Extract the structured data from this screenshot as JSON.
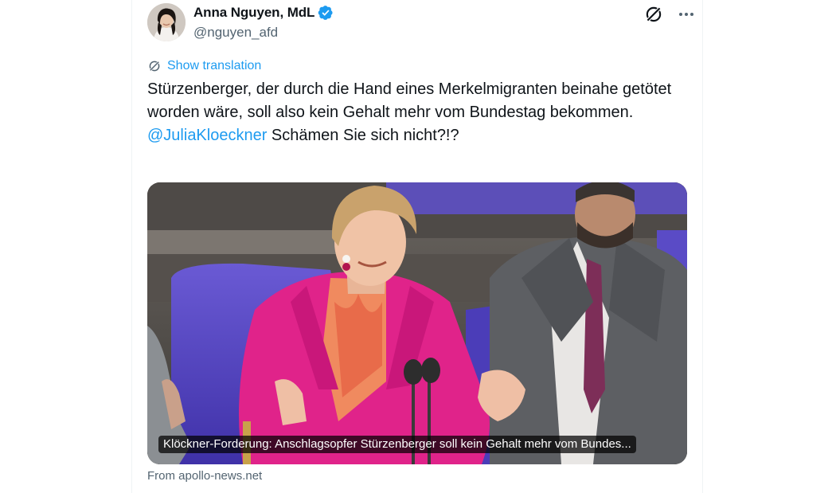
{
  "author": {
    "display_name": "Anna Nguyen, MdL",
    "handle": "@nguyen_afd",
    "verified": true,
    "avatar_icon": "profile-photo"
  },
  "actions": {
    "grok_icon": "grok-slash-circle-icon",
    "more_icon": "more-dots-icon"
  },
  "translation": {
    "label": "Show translation",
    "icon": "translate-icon"
  },
  "tweet": {
    "paragraph1": "Stürzenberger, der durch die Hand eines Merkelmigranten beinahe getötet worden wäre, soll also kein Gehalt mehr vom Bundestag bekommen.",
    "mention": "@JuliaKloeckner",
    "paragraph2_rest": " Schämen Sie sich nicht?!?"
  },
  "link_card": {
    "caption": "Klöckner-Forderung: Anschlagsopfer Stürzenberger soll kein Gehalt mehr vom Bundes...",
    "source": "From apollo-news.net"
  },
  "colors": {
    "link_blue": "#1d9bf0",
    "text_primary": "#0f1419",
    "text_secondary": "#536471",
    "verified_blue": "#1d9bf0",
    "jacket_pink": "#e0238a",
    "seat_purple": "#5a4bc6"
  }
}
